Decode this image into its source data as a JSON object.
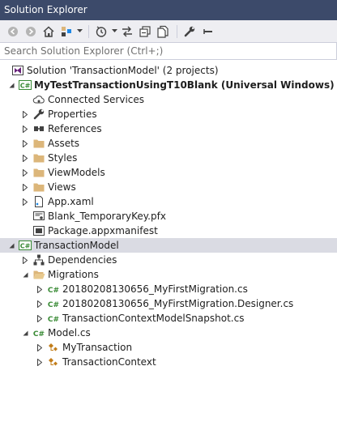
{
  "window": {
    "title": "Solution Explorer"
  },
  "toolbar": {
    "buttons": [
      "back-icon",
      "forward-icon",
      "home-icon",
      "switch-views-icon",
      "pending-changes-filter-icon",
      "sync-icon",
      "collapse-all-icon",
      "show-all-files-icon",
      "properties-wrench-icon",
      "preview-icon"
    ]
  },
  "search": {
    "placeholder": "Search Solution Explorer (Ctrl+;)"
  },
  "tree": {
    "solution": "Solution 'TransactionModel' (2 projects)",
    "project1": {
      "name": "MyTestTransactionUsingT10Blank (Universal Windows)",
      "connected_services": "Connected Services",
      "properties": "Properties",
      "references": "References",
      "assets": "Assets",
      "styles": "Styles",
      "viewmodels": "ViewModels",
      "views": "Views",
      "app_xaml": "App.xaml",
      "pfx": "Blank_TemporaryKey.pfx",
      "manifest": "Package.appxmanifest"
    },
    "project2": {
      "name": "TransactionModel",
      "dependencies": "Dependencies",
      "migrations": "Migrations",
      "mig1": "20180208130656_MyFirstMigration.cs",
      "mig2": "20180208130656_MyFirstMigration.Designer.cs",
      "snapshot": "TransactionContextModelSnapshot.cs",
      "model": "Model.cs",
      "class1": "MyTransaction",
      "class2": "TransactionContext"
    }
  },
  "colors": {
    "titlebar": "#3c4a6a",
    "toolbar": "#eeeef2",
    "selection": "#dadbe3",
    "csharp_green": "#388a34",
    "folder": "#dcb67a",
    "class_orange": "#c27d1a"
  }
}
